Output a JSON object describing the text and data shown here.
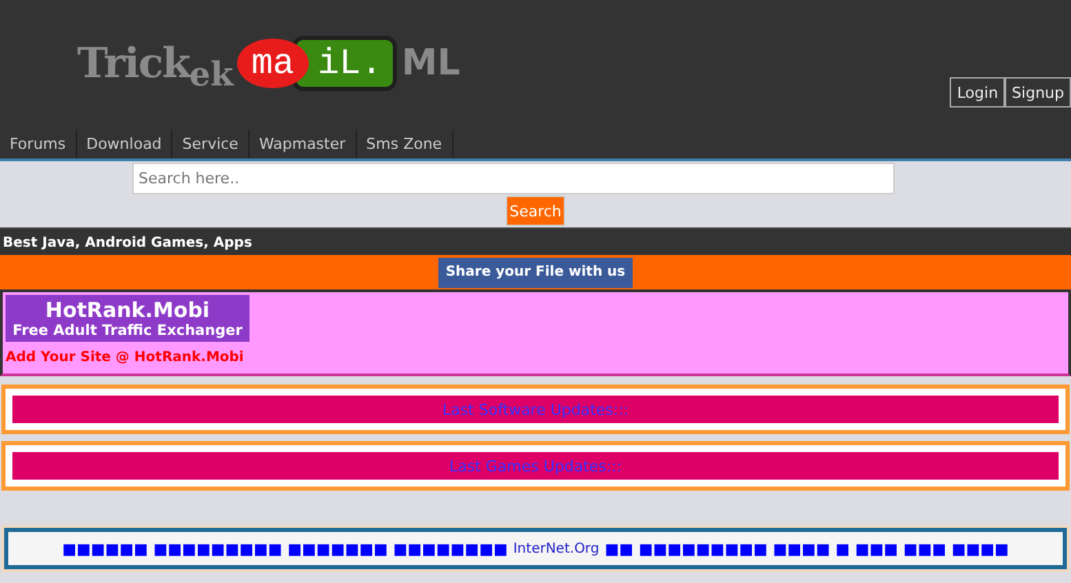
{
  "logo": {
    "first": "Trick",
    "second": "ek",
    "red": "ma",
    "green": "iL.",
    "tail": "ML"
  },
  "auth_buttons": [
    "Login",
    "Signup"
  ],
  "nav": [
    "Forums",
    "Download",
    "Service",
    "Wapmaster",
    "Sms Zone"
  ],
  "search": {
    "placeholder": "Search here..",
    "button": "Search"
  },
  "tagline": "Best Java, Android Games, Apps",
  "share_button": "Share your File with us",
  "ad": {
    "title": "HotRank.Mobi",
    "subtitle": "Free Adult Traffic Exchanger",
    "link": "Add Your Site @ HotRank.Mobi"
  },
  "sections": [
    "Last Software Updates:::",
    "Last Games Updates:::"
  ],
  "footer": {
    "before": "■■■■■■ ■■■■■■■■■ ■■■■■■■ ■■■■■■■■",
    "link": "InterNet.Org",
    "after": "■■ ■■■■■■■■■ ■■■■ ■ ■■■ ■■■ ■■■■"
  }
}
